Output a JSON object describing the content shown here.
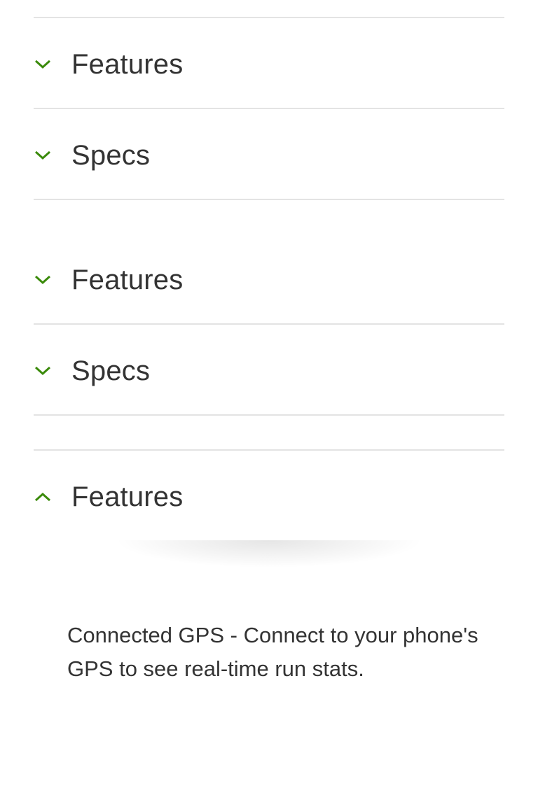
{
  "accordion_groups": [
    {
      "items": [
        {
          "label": "Features",
          "expanded": false,
          "icon": "chevron-down-icon"
        },
        {
          "label": "Specs",
          "expanded": false,
          "icon": "chevron-down-icon"
        }
      ]
    },
    {
      "items": [
        {
          "label": "Features",
          "expanded": false,
          "icon": "chevron-down-icon"
        },
        {
          "label": "Specs",
          "expanded": false,
          "icon": "chevron-down-icon"
        }
      ]
    },
    {
      "items": [
        {
          "label": "Features",
          "expanded": true,
          "icon": "chevron-up-icon",
          "content": "Connected GPS - Connect to your phone's GPS to see real-time run stats."
        }
      ]
    }
  ],
  "colors": {
    "accent": "#3a8a0a",
    "text": "#333333",
    "divider": "#e3e3e3"
  }
}
